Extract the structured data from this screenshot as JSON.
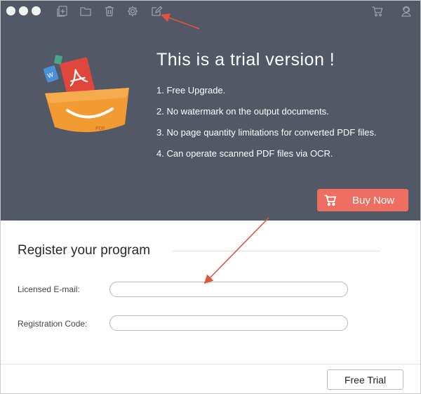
{
  "toolbar": {
    "window_controls": [
      "close",
      "minimize",
      "zoom"
    ],
    "icons": [
      "add-file-icon",
      "folder-icon",
      "trash-icon",
      "gear-icon",
      "edit-icon",
      "cart-icon",
      "support-icon"
    ]
  },
  "hero": {
    "title": "This is a trial version !",
    "features": [
      "1. Free Upgrade.",
      "2. No watermark on the output documents.",
      "3. No page quantity limitations for converted PDF files.",
      "4. Can operate scanned PDF files via OCR."
    ],
    "buy_label": "Buy Now",
    "graphic_label": "PDF"
  },
  "register": {
    "title": "Register your program",
    "email_label": "Licensed E-mail:",
    "email_value": "",
    "code_label": "Registration Code:",
    "code_value": ""
  },
  "footer": {
    "free_trial_label": "Free Trial"
  },
  "colors": {
    "header_bg": "#525865",
    "buy_button": "#ee6f62",
    "annotation_arrow": "#e0553c",
    "box_orange": "#f39b33"
  }
}
